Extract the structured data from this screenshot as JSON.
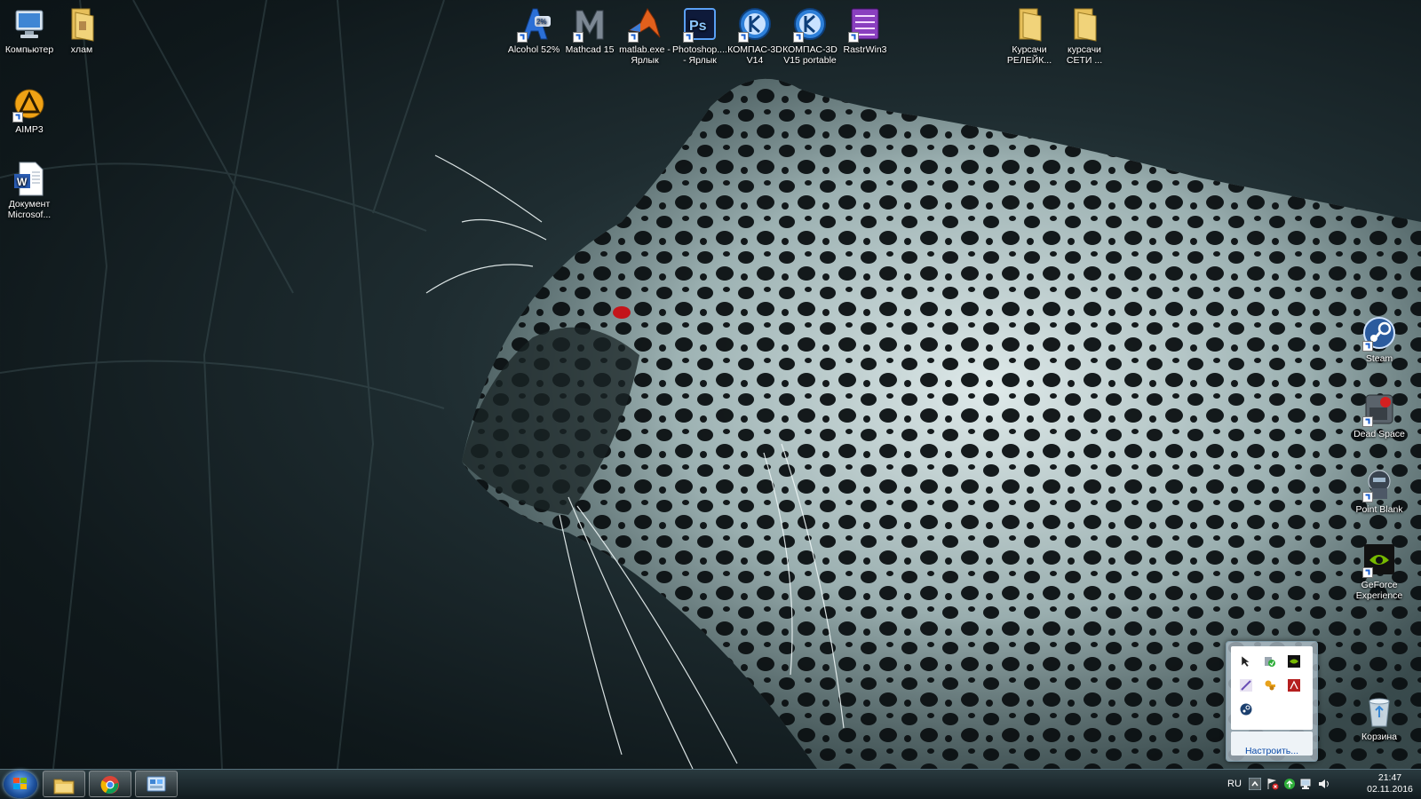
{
  "desktop": {
    "icons": [
      {
        "id": "computer",
        "label": "Компьютер",
        "icon": "computer-icon"
      },
      {
        "id": "hlam",
        "label": "хлам",
        "icon": "folder-icon"
      },
      {
        "id": "aimp",
        "label": "AIMP3",
        "icon": "aimp-icon"
      },
      {
        "id": "word-doc",
        "label": "Документ Microsof...",
        "icon": "word-document-icon"
      },
      {
        "id": "alcohol",
        "label": "Alcohol 52%",
        "icon": "alcohol-icon"
      },
      {
        "id": "mathcad",
        "label": "Mathcad 15",
        "icon": "mathcad-icon"
      },
      {
        "id": "matlab",
        "label": "matlab.exe - Ярлык",
        "icon": "matlab-icon"
      },
      {
        "id": "photoshop",
        "label": "Photoshop.... - Ярлык",
        "icon": "photoshop-icon"
      },
      {
        "id": "kompas14",
        "label": "КОМПАС-3D V14",
        "icon": "kompas-icon"
      },
      {
        "id": "kompas15",
        "label": "КОМПАС-3D V15 portable",
        "icon": "kompas-icon"
      },
      {
        "id": "rastrwin",
        "label": "RastrWin3",
        "icon": "rastrwin-icon"
      },
      {
        "id": "kursachi-rele",
        "label": "Курсачи РЕЛЕЙК...",
        "icon": "folder-icon"
      },
      {
        "id": "kursachi-seti",
        "label": "курсачи СЕТИ ...",
        "icon": "folder-icon"
      },
      {
        "id": "steam",
        "label": "Steam",
        "icon": "steam-icon"
      },
      {
        "id": "deadspace",
        "label": "Dead Space",
        "icon": "dead-space-icon"
      },
      {
        "id": "pointblank",
        "label": "Point Blank",
        "icon": "point-blank-icon"
      },
      {
        "id": "geforce",
        "label": "GeForce Experience",
        "icon": "nvidia-icon"
      },
      {
        "id": "recycle",
        "label": "Корзина",
        "icon": "recycle-bin-icon"
      }
    ]
  },
  "tray_popup": {
    "customize_label": "Настроить...",
    "icons": [
      "cursor-tool-icon",
      "shield-check-icon",
      "nvidia-tray-icon",
      "pen-icon",
      "keys-icon",
      "acrobat-icon",
      "steam-tray-icon"
    ]
  },
  "taskbar": {
    "pinned": [
      "explorer-icon",
      "chrome-icon",
      "control-panel-icon"
    ],
    "language": "RU",
    "time": "21:47",
    "date": "02.11.2016"
  }
}
